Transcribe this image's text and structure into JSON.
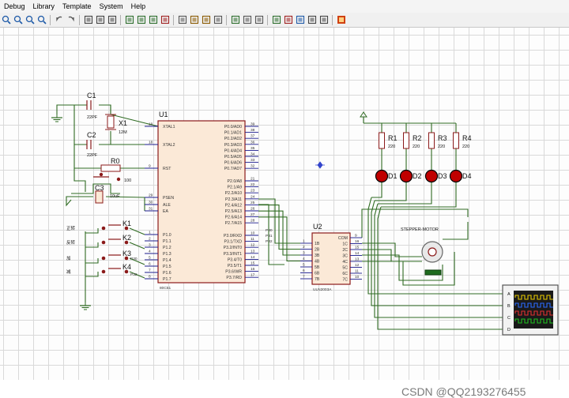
{
  "menu": [
    "Debug",
    "Library",
    "Template",
    "System",
    "Help"
  ],
  "toolbar_icons": [
    "zoom-in-icon",
    "zoom-out-icon",
    "zoom-all-icon",
    "zoom-area-icon",
    "undo-icon",
    "redo-icon",
    "cut-icon",
    "copy-icon",
    "paste-icon",
    "block-copy-icon",
    "block-move-icon",
    "block-rotate-icon",
    "block-delete-icon",
    "pick-device-icon",
    "make-device-icon",
    "packaging-icon",
    "decompose-icon",
    "wire-autorouter-icon",
    "search-tag-icon",
    "property-assign-icon",
    "new-sheet-icon",
    "remove-sheet-icon",
    "goto-sheet-icon",
    "bill-of-materials-icon",
    "netlist-icon",
    "ares-icon"
  ],
  "schematic": {
    "c1": {
      "ref": "C1",
      "value": "22PF"
    },
    "c2": {
      "ref": "C2",
      "value": "22PF"
    },
    "x1": {
      "ref": "X1",
      "value": "12M"
    },
    "r0": {
      "ref": "R0",
      "value": "100"
    },
    "c3": {
      "ref": "C3",
      "value": "10uF"
    },
    "u1": {
      "ref": "U1",
      "part": "80C51",
      "left_pins": [
        {
          "name": "XTAL1",
          "num": "19"
        },
        {
          "name": "XTAL2",
          "num": "18"
        },
        {
          "name": "RST",
          "num": "9"
        },
        {
          "name": "PSEN",
          "num": "29"
        },
        {
          "name": "ALE",
          "num": "30"
        },
        {
          "name": "EA",
          "num": "31"
        },
        {
          "name": "P1.0",
          "num": "1"
        },
        {
          "name": "P1.1",
          "num": "2"
        },
        {
          "name": "P1.2",
          "num": "3"
        },
        {
          "name": "P1.3",
          "num": "4"
        },
        {
          "name": "P1.4",
          "num": "5"
        },
        {
          "name": "P1.5",
          "num": "6"
        },
        {
          "name": "P1.6",
          "num": "7"
        },
        {
          "name": "P1.7",
          "num": "8"
        }
      ],
      "right_pins": [
        {
          "name": "P0.0/AD0",
          "num": "39"
        },
        {
          "name": "P0.1/AD1",
          "num": "38"
        },
        {
          "name": "P0.2/AD2",
          "num": "37"
        },
        {
          "name": "P0.3/AD3",
          "num": "36"
        },
        {
          "name": "P0.4/AD4",
          "num": "35"
        },
        {
          "name": "P0.5/AD5",
          "num": "34"
        },
        {
          "name": "P0.6/AD6",
          "num": "33"
        },
        {
          "name": "P0.7/AD7",
          "num": "32"
        },
        {
          "name": "P2.0/A8",
          "num": "21"
        },
        {
          "name": "P2.1/A9",
          "num": "22"
        },
        {
          "name": "P2.2/A10",
          "num": "23"
        },
        {
          "name": "P2.3/A11",
          "num": "24"
        },
        {
          "name": "P2.4/A12",
          "num": "25"
        },
        {
          "name": "P2.5/A13",
          "num": "26"
        },
        {
          "name": "P2.6/A14",
          "num": "27"
        },
        {
          "name": "P2.7/A15",
          "num": "28"
        },
        {
          "name": "P3.0/RXD",
          "num": "10"
        },
        {
          "name": "P3.1/TXD",
          "num": "11"
        },
        {
          "name": "P3.2/INT0",
          "num": "12"
        },
        {
          "name": "P3.3/INT1",
          "num": "13"
        },
        {
          "name": "P3.4/T0",
          "num": "14"
        },
        {
          "name": "P3.5/T1",
          "num": "15"
        },
        {
          "name": "P3.6/WR",
          "num": "16"
        },
        {
          "name": "P3.7/RD",
          "num": "17"
        }
      ]
    },
    "keys": [
      {
        "ref": "K1",
        "label": "正转"
      },
      {
        "ref": "K2",
        "label": "反转"
      },
      {
        "ref": "K3",
        "label": "加"
      },
      {
        "ref": "K4",
        "label": "减"
      }
    ],
    "key_nets": [
      "P30",
      "P31",
      "P32"
    ],
    "u2": {
      "ref": "U2",
      "part": "ULN2003A",
      "left_pins": [
        {
          "name": "1B",
          "num": "1"
        },
        {
          "name": "2B",
          "num": "2"
        },
        {
          "name": "3B",
          "num": "3"
        },
        {
          "name": "4B",
          "num": "4"
        },
        {
          "name": "5B",
          "num": "5"
        },
        {
          "name": "6B",
          "num": "6"
        },
        {
          "name": "7B",
          "num": "7"
        }
      ],
      "right_pins": [
        {
          "name": "COM",
          "num": "9"
        },
        {
          "name": "1C",
          "num": "16"
        },
        {
          "name": "2C",
          "num": "15"
        },
        {
          "name": "3C",
          "num": "14"
        },
        {
          "name": "4C",
          "num": "13"
        },
        {
          "name": "5C",
          "num": "12"
        },
        {
          "name": "6C",
          "num": "11"
        },
        {
          "name": "7C",
          "num": "10"
        }
      ]
    },
    "resistors": [
      {
        "ref": "R1",
        "value": "220"
      },
      {
        "ref": "R2",
        "value": "220"
      },
      {
        "ref": "R3",
        "value": "220"
      },
      {
        "ref": "R4",
        "value": "220"
      }
    ],
    "leds": [
      "D1",
      "D2",
      "D3",
      "D4"
    ],
    "motor": {
      "label": "STEPPER-MOTOR"
    },
    "scope_channels": [
      "A",
      "B",
      "C",
      "D"
    ]
  },
  "watermark": "CSDN @QQ2193276455",
  "colors": {
    "wire": "#2f6b22",
    "component": "#8b1a1a",
    "pin": "#1a1a8b",
    "led": "#c00000",
    "scope_bg": "#1a1a1a",
    "canvas_grid": "#d9d9d9"
  }
}
